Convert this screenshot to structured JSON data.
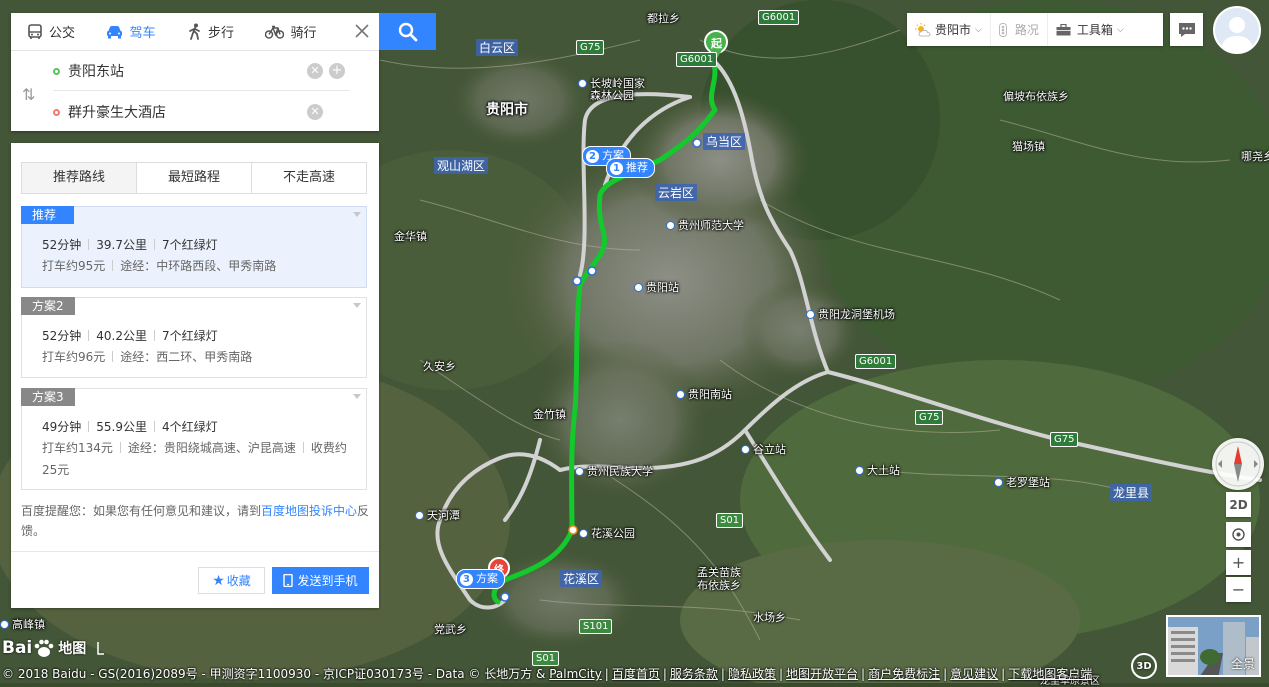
{
  "modes": [
    {
      "label": "公交",
      "icon": "bus-icon",
      "active": false
    },
    {
      "label": "驾车",
      "icon": "car-icon",
      "active": true
    },
    {
      "label": "步行",
      "icon": "walk-icon",
      "active": false
    },
    {
      "label": "骑行",
      "icon": "bike-icon",
      "active": false
    }
  ],
  "route": {
    "start": "贵阳东站",
    "end": "群升豪生大酒店"
  },
  "tabs": [
    "推荐路线",
    "最短路程",
    "不走高速"
  ],
  "plans": [
    {
      "tag": "推荐",
      "time": "52分钟",
      "dist": "39.7公里",
      "lights": "7个红绿灯",
      "taxi": "打车约95元",
      "via": "途经：中环路西段、甲秀南路",
      "toll": ""
    },
    {
      "tag": "方案2",
      "time": "52分钟",
      "dist": "40.2公里",
      "lights": "7个红绿灯",
      "taxi": "打车约96元",
      "via": "途经：西二环、甲秀南路",
      "toll": ""
    },
    {
      "tag": "方案3",
      "time": "49分钟",
      "dist": "55.9公里",
      "lights": "4个红绿灯",
      "taxi": "打车约134元",
      "via": "途经：贵阳绕城高速、沪昆高速",
      "toll": "收费约25元"
    }
  ],
  "tip": {
    "pre": "百度提醒您：如果您有任何意见和建议，请到",
    "link": "百度地图投诉中心",
    "post": "反馈。"
  },
  "buttons": {
    "fav": "收藏",
    "send": "发送到手机"
  },
  "toolbar": {
    "city": "贵阳市",
    "traffic": "路况",
    "tools": "工具箱"
  },
  "controls": {
    "view": "2D",
    "zoom_in": "+",
    "zoom_out": "−",
    "threed": "3D",
    "pano": "全景"
  },
  "logo": {
    "text1": "Bai",
    "text2": "地图"
  },
  "copyright": {
    "text": "© 2018 Baidu - GS(2016)2089号 - 甲测资字1100930 - 京ICP证030173号 - Data © 长地万方 &",
    "palmcity": "PalmCity",
    "links": [
      "百度首页",
      "服务条款",
      "隐私政策",
      "地图开放平台",
      "商户免费标注",
      "意见建议",
      "下载地图客户端"
    ]
  },
  "map_labels": {
    "districts": [
      "白云区",
      "贵阳市",
      "观山湖区",
      "乌当区",
      "云岩区",
      "花溪区",
      "龙里县"
    ],
    "places": [
      "都拉乡",
      "偏坡布依族乡",
      "猫场镇",
      "哪尧乡",
      "金华镇",
      "久安乡",
      "金竹镇",
      "天河潭",
      "党武乡",
      "高峰镇",
      "孟关苗族布依族乡",
      "水场乡",
      "大土站",
      "老罗堡站",
      "谷立站",
      "龙里草原景区"
    ],
    "pois": [
      "长坡岭国家森林公园",
      "贵州师范大学",
      "贵阳站",
      "贵阳龙洞堡机场",
      "贵阳南站",
      "贵州民族大学",
      "花溪公园"
    ],
    "roads": [
      "G6001",
      "G75",
      "G6001",
      "G6001",
      "G75",
      "G75",
      "S01",
      "S101",
      "S01"
    ],
    "route_bubbles": [
      {
        "n": "2",
        "label": "方案"
      },
      {
        "n": "1",
        "label": "推荐"
      },
      {
        "n": "3",
        "label": "方案"
      }
    ],
    "start_marker": "起",
    "end_marker": "终"
  },
  "colors": {
    "accent": "#3385ff",
    "route": "#13c92c",
    "alt_route": "#cfcfcf"
  }
}
